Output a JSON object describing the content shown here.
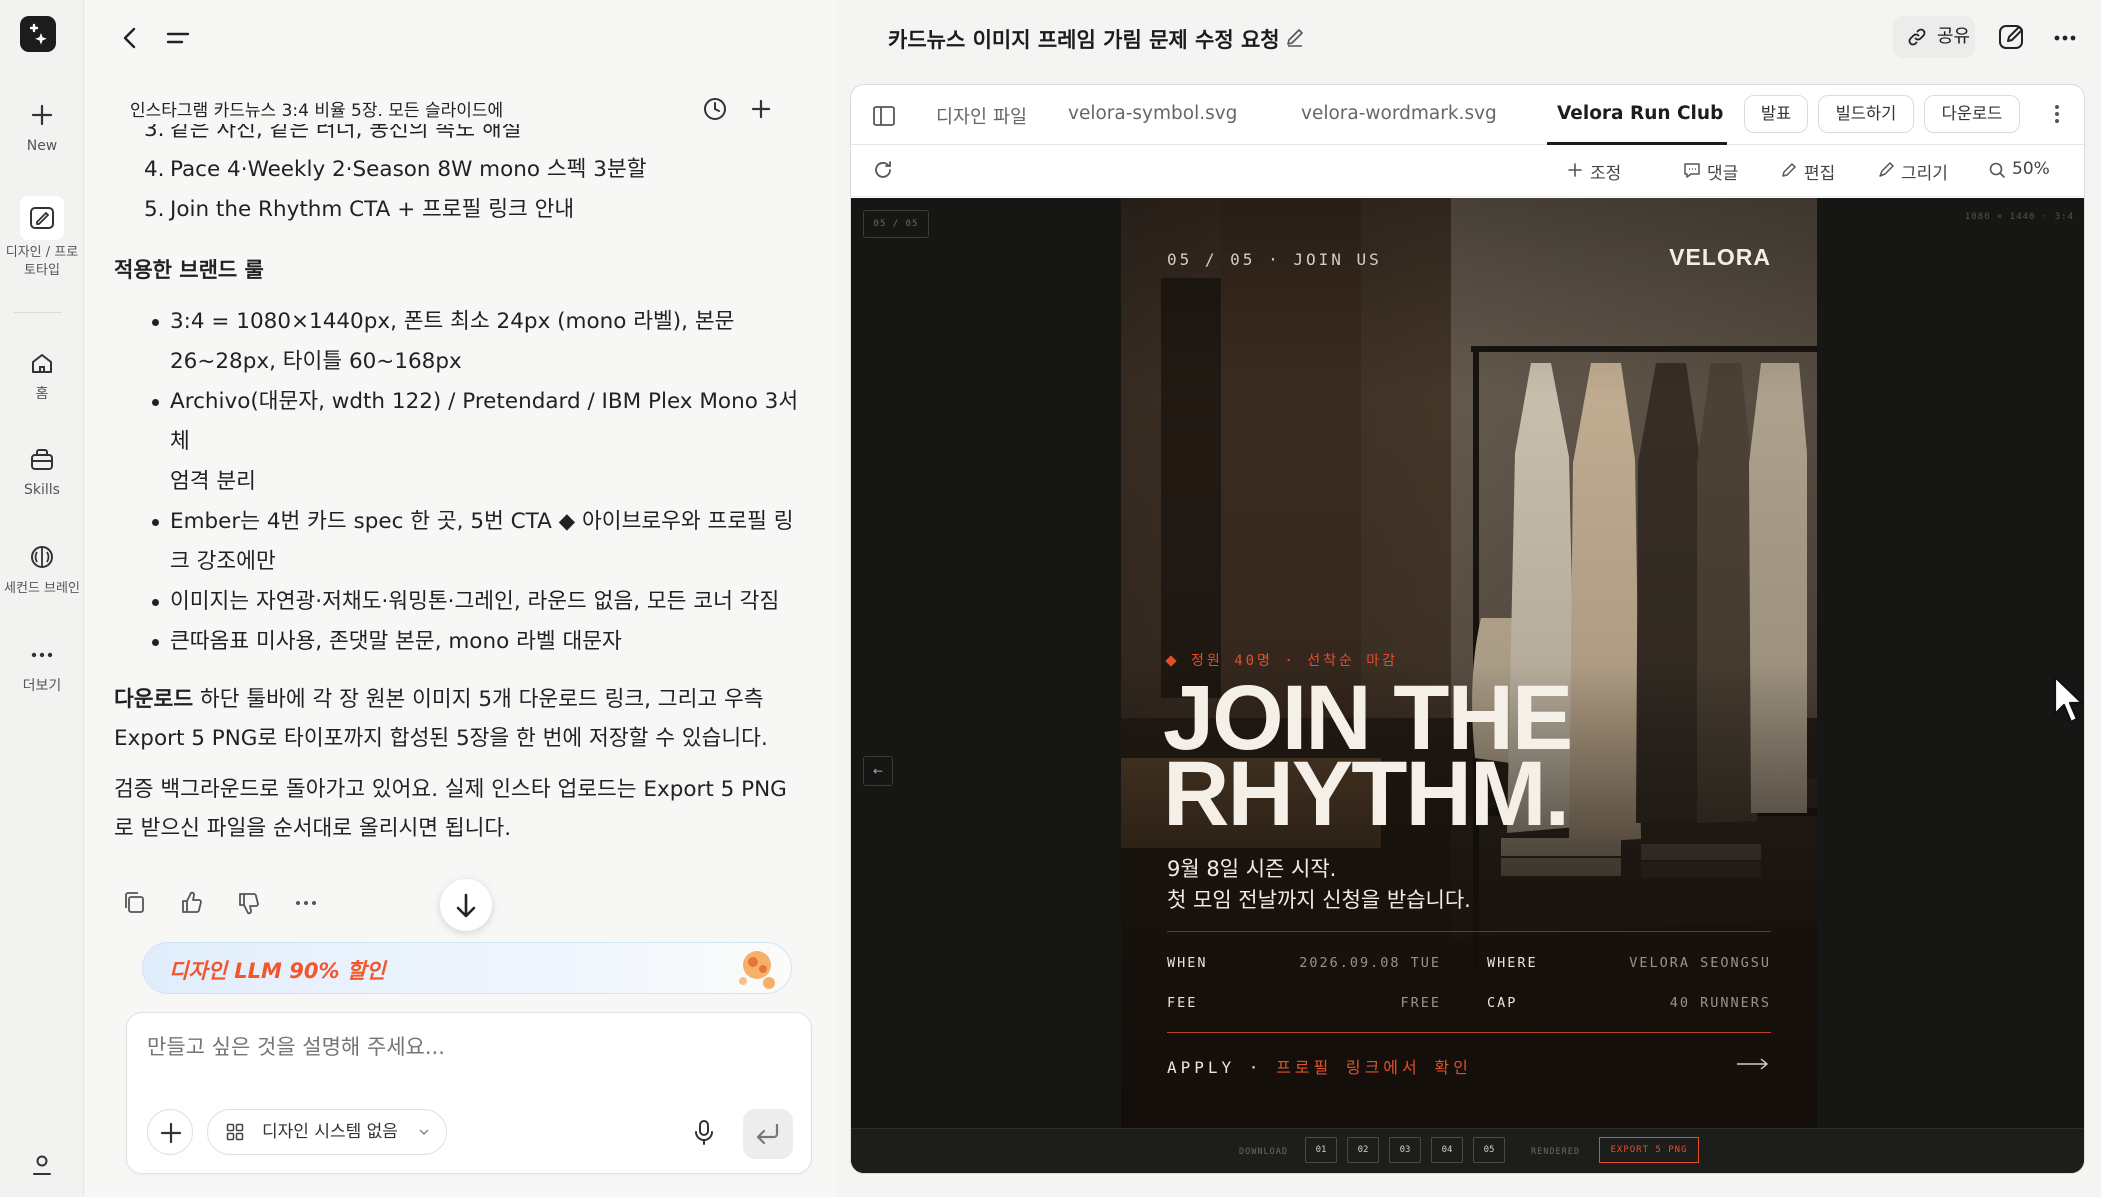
{
  "rail": {
    "new_label": "New",
    "design_label_1": "디자인 / 프로",
    "design_label_2": "토타입",
    "home_label": "홈",
    "skills_label": "Skills",
    "brain_label": "세컨드 브레인",
    "more_label": "더보기"
  },
  "header": {
    "title": "카드뉴스 이미지 프레임 가림 문제 수정 요청",
    "share_label": "공유"
  },
  "chat": {
    "session_title": "인스타그램 카드뉴스 3:4 비율 5장. 모든 슬라이드에",
    "list_items": [
      {
        "num": "3.",
        "text": "같은 사진, 같은 러너, 동선의 속도 해설"
      },
      {
        "num": "4.",
        "text": "Pace 4·Weekly 2·Season 8W mono 스펙 3분할"
      },
      {
        "num": "5.",
        "text": "Join the Rhythm CTA + 프로필 링크 안내"
      }
    ],
    "rules_heading": "적용한 브랜드 룰",
    "rules": [
      {
        "line1": "3:4 = 1080×1440px, 폰트 최소 24px (mono 라벨), 본문",
        "line2": "26~28px, 타이틀 60~168px"
      },
      {
        "line1": "Archivo(대문자, wdth 122) / Pretendard / IBM Plex Mono 3서체",
        "line2": "엄격 분리"
      },
      {
        "line1": "Ember는 4번 카드 spec 한 곳, 5번 CTA ◆ 아이브로우와 프로필 링",
        "line2": "크 강조에만"
      },
      {
        "line1": "이미지는 자연광·저채도·워밍톤·그레인, 라운드 없음, 모든 코너 각짐",
        "line2": ""
      },
      {
        "line1": "큰따옴표 미사용, 존댓말 본문, mono 라벨 대문자",
        "line2": ""
      }
    ],
    "download_bold": "다운로드",
    "download_line1": " 하단 툴바에 각 장 원본 이미지 5개 다운로드 링크, 그리고 우측",
    "download_line2": "Export 5 PNG로 타이포까지 합성된 5장을 한 번에 저장할 수 있습니다.",
    "verify_line1": "검증 백그라운드로 돌아가고 있어요. 실제 인스타 업로드는 Export 5 PNG",
    "verify_line2": "로 받으신 파일을 순서대로 올리시면 됩니다.",
    "promo": "디자인 LLM 90% 할인",
    "composer_placeholder": "만들고 싶은 것을 설명해 주세요...",
    "design_system": "디자인 시스템 없음"
  },
  "panel": {
    "tabs": [
      "디자인 파일",
      "velora-symbol.svg",
      "velora-wordmark.svg",
      "Velora Run Club Ca"
    ],
    "buttons": [
      "발표",
      "빌드하기",
      "다운로드"
    ],
    "toolbar": [
      "조정",
      "댓글",
      "편집",
      "그리기",
      "50%"
    ],
    "canvas_badge": "05 / 05",
    "canvas_dims": "1080 × 1440 · 3:4",
    "prev_arrow": "←"
  },
  "slide": {
    "counter": "05 / 05 · JOIN US",
    "logo": "VELORA",
    "tag": "정원 40명 · 선착순 마감",
    "headline_1": "JOIN THE",
    "headline_2": "RHYTHM.",
    "sub_1": "9월 8일 시즌 시작.",
    "sub_2": "첫 모임 전날까지 신청을 받습니다.",
    "when_k": "WHEN",
    "when_v": "2026.09.08 TUE",
    "where_k": "WHERE",
    "where_v": "VELORA SEONGSU",
    "fee_k": "FEE",
    "fee_v": "FREE",
    "cap_k": "CAP",
    "cap_v": "40 RUNNERS",
    "apply": "APPLY · ",
    "apply_link": "프로필 링크에서 확인"
  },
  "bottombar": {
    "download_label": "DOWNLOAD",
    "slides": [
      "01",
      "02",
      "03",
      "04",
      "05"
    ],
    "rendered_label": "RENDERED",
    "export_label": "EXPORT 5 PNG"
  },
  "colors": {
    "ember": "#e2502a",
    "promo_text": "#f2562d",
    "canvas_bg": "#161614",
    "slide_bg": "#2a231d"
  }
}
